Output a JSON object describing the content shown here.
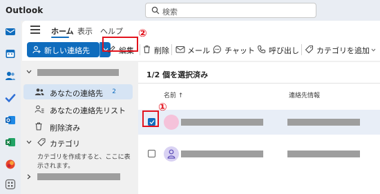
{
  "app": {
    "title": "Outlook"
  },
  "search": {
    "placeholder": "検索"
  },
  "ribbon": {
    "tabs": [
      "ホーム",
      "表示",
      "ヘルプ"
    ],
    "new_contact": "新しい連絡先",
    "edit": "編集",
    "delete": "削除",
    "mail": "メール",
    "chat": "チャット",
    "call": "呼び出し",
    "add_category": "カテゴリを追加"
  },
  "annotations": {
    "one": "①",
    "two": "②"
  },
  "folders": {
    "my_contacts": {
      "label": "あなたの連絡先",
      "count": "2"
    },
    "contact_lists": "あなたの連絡先リスト",
    "deleted": "削除済み",
    "categories": "カテゴリ",
    "category_hint": "カテゴリを作成すると、ここに表示されます。"
  },
  "list": {
    "selection_status": "1/2 個を選択済み",
    "col_name": "名前 ↑",
    "col_contact_info": "連絡先情報"
  },
  "colors": {
    "accent": "#0f6cbd",
    "annotation_red": "#e3121c",
    "selected_row": "#e8eef7",
    "redaction": "#9e9e9e"
  },
  "icons": [
    "search-icon",
    "mail-icon",
    "calendar-icon",
    "people-icon",
    "todo-icon",
    "outlook-icon",
    "excel-icon",
    "office-icon",
    "apps-icon",
    "hamburger-icon",
    "person-add-icon",
    "pencil-icon",
    "trash-icon",
    "chat-icon",
    "phone-icon",
    "tag-icon",
    "chevron-down-icon",
    "chevron-right-icon",
    "checkmark-icon",
    "person-icon"
  ]
}
